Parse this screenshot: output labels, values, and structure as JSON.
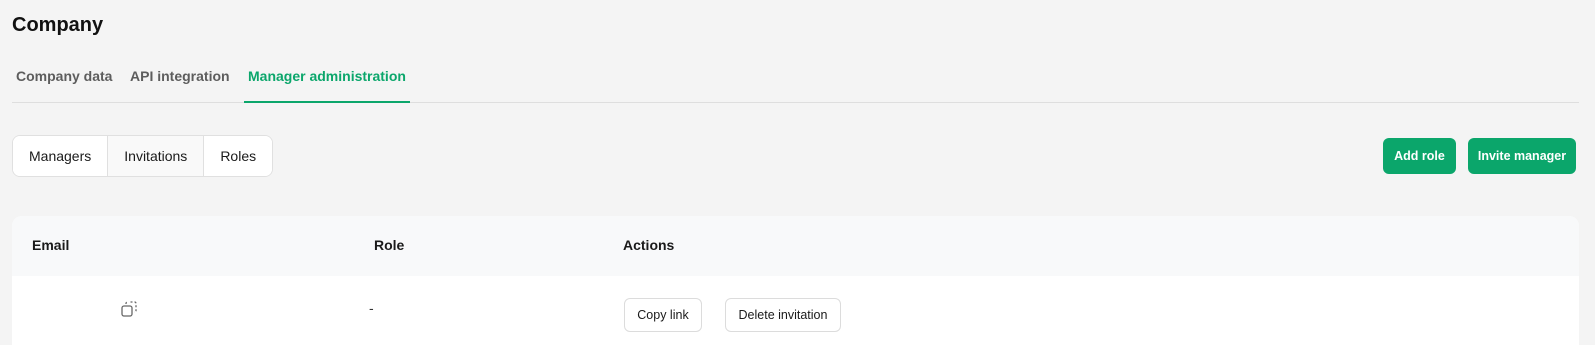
{
  "page": {
    "title": "Company"
  },
  "tabs": [
    {
      "label": "Company data"
    },
    {
      "label": "API integration"
    },
    {
      "label": "Manager administration"
    }
  ],
  "subnav": [
    {
      "label": "Managers"
    },
    {
      "label": "Invitations"
    },
    {
      "label": "Roles"
    }
  ],
  "actions": {
    "add_role": "Add role",
    "invite_manager": "Invite manager"
  },
  "table": {
    "columns": [
      "Email",
      "Role",
      "Actions"
    ],
    "rows": [
      {
        "email_icon": "copy-icon",
        "role": "-",
        "copy_link": "Copy link",
        "delete_invitation": "Delete invitation"
      }
    ]
  },
  "colors": {
    "accent": "#0ba66b",
    "background": "#f4f4f4"
  }
}
